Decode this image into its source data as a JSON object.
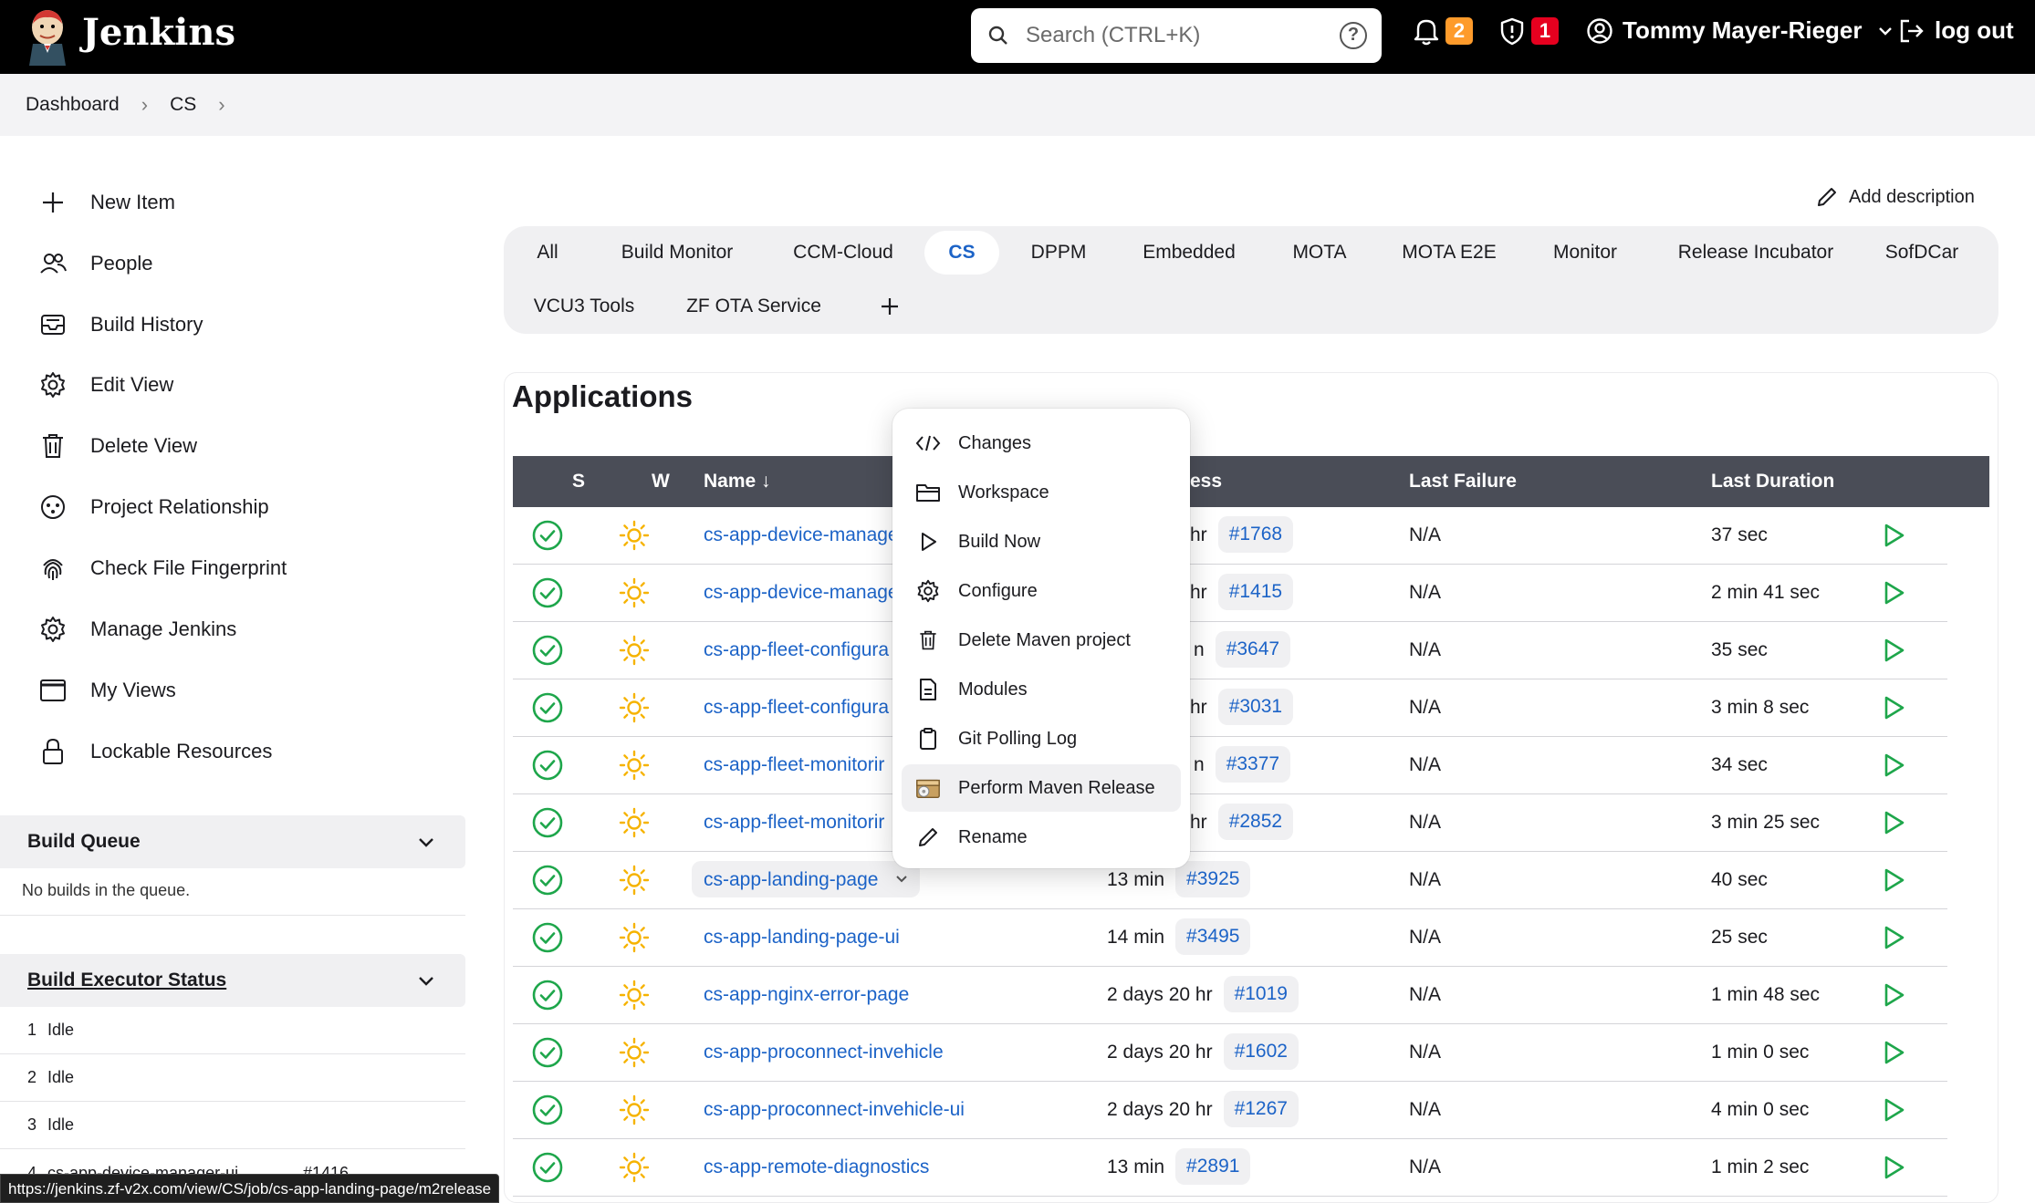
{
  "header": {
    "brand": "Jenkins",
    "search_placeholder": "Search (CTRL+K)",
    "notifications_count": "2",
    "security_count": "1",
    "user_name": "Tommy Mayer-Rieger",
    "logout_label": "log out"
  },
  "breadcrumb": [
    "Dashboard",
    "CS"
  ],
  "sidebar": {
    "tasks": [
      "New Item",
      "People",
      "Build History",
      "Edit View",
      "Delete View",
      "Project Relationship",
      "Check File Fingerprint",
      "Manage Jenkins",
      "My Views",
      "Lockable Resources"
    ],
    "build_queue_title": "Build Queue",
    "build_queue_empty": "No builds in the queue.",
    "executor_title": "Build Executor Status",
    "executors": [
      {
        "num": "1",
        "status": "Idle"
      },
      {
        "num": "2",
        "status": "Idle"
      },
      {
        "num": "3",
        "status": "Idle"
      }
    ],
    "executor_4_partial": "cs-app-device-manager-ui",
    "executor_4_build": "#1416"
  },
  "add_description": "Add description",
  "tabs": [
    "All",
    "Build Monitor",
    "CCM-Cloud",
    "CS",
    "DPPM",
    "Embedded",
    "MOTA",
    "MOTA E2E",
    "Monitor",
    "Release Incubator",
    "SofDCar",
    "VCU3 Tools",
    "ZF OTA Service"
  ],
  "active_tab": "CS",
  "section_title": "Applications",
  "table": {
    "headers": {
      "s": "S",
      "w": "W",
      "name": "Name ↓",
      "last_success_partial": "ess",
      "last_failure": "Last Failure",
      "last_duration": "Last Duration"
    },
    "rows": [
      {
        "name": "cs-app-device-manage",
        "since": "hr",
        "build": "#1768",
        "failure": "N/A",
        "duration": "37 sec"
      },
      {
        "name": "cs-app-device-manage",
        "since": "hr",
        "build": "#1415",
        "failure": "N/A",
        "duration": "2 min 41 sec"
      },
      {
        "name": "cs-app-fleet-configura",
        "since": "n",
        "build": "#3647",
        "failure": "N/A",
        "duration": "35 sec"
      },
      {
        "name": "cs-app-fleet-configura",
        "since": "hr",
        "build": "#3031",
        "failure": "N/A",
        "duration": "3 min 8 sec"
      },
      {
        "name": "cs-app-fleet-monitorir",
        "since": "n",
        "build": "#3377",
        "failure": "N/A",
        "duration": "34 sec"
      },
      {
        "name": "cs-app-fleet-monitorir",
        "since": "hr",
        "build": "#2852",
        "failure": "N/A",
        "duration": "3 min 25 sec"
      },
      {
        "name": "cs-app-landing-page",
        "since": "13 min",
        "build": "#3925",
        "failure": "N/A",
        "duration": "40 sec"
      },
      {
        "name": "cs-app-landing-page-ui",
        "since": "14 min",
        "build": "#3495",
        "failure": "N/A",
        "duration": "25 sec"
      },
      {
        "name": "cs-app-nginx-error-page",
        "since": "2 days 20 hr",
        "build": "#1019",
        "failure": "N/A",
        "duration": "1 min 48 sec"
      },
      {
        "name": "cs-app-proconnect-invehicle",
        "since": "2 days 20 hr",
        "build": "#1602",
        "failure": "N/A",
        "duration": "1 min 0 sec"
      },
      {
        "name": "cs-app-proconnect-invehicle-ui",
        "since": "2 days 20 hr",
        "build": "#1267",
        "failure": "N/A",
        "duration": "4 min 0 sec"
      },
      {
        "name": "cs-app-remote-diagnostics",
        "since": "13 min",
        "build": "#2891",
        "failure": "N/A",
        "duration": "1 min 2 sec"
      }
    ]
  },
  "context_menu": [
    "Changes",
    "Workspace",
    "Build Now",
    "Configure",
    "Delete Maven project",
    "Modules",
    "Git Polling Log",
    "Perform Maven Release",
    "Rename"
  ],
  "status_url": "https://jenkins.zf-v2x.com/view/CS/job/cs-app-landing-page/m2release",
  "colors": {
    "accent": "#1c63c7",
    "success": "#1ea64b",
    "weather": "#f6b300",
    "header": "#000000"
  }
}
